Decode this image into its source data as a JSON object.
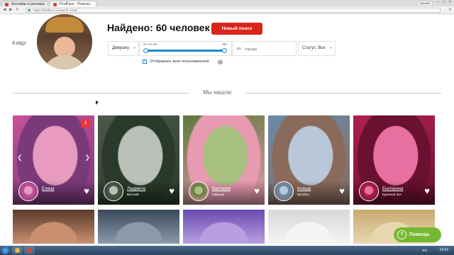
{
  "browser": {
    "tabs": [
      {
        "label": "Анонимы и реклама",
        "color": "#d04a3a"
      },
      {
        "label": "FindFace - Результ...",
        "color": "#d04a3a"
      }
    ],
    "user_label": "Ultimate",
    "url": "https://findface.ru/search-result"
  },
  "header": {
    "looking_for": "Я ИЩУ",
    "found_title": "Найдено: 60 человек",
    "new_search_label": "Новый поиск"
  },
  "filters": {
    "gender": "Девушку",
    "age_from": "От 14 лет",
    "age_to": "55+",
    "age_range_fraction": [
      0.0,
      1.0
    ],
    "city_prefix": "из",
    "city_placeholder": "города",
    "status": "Статус: Все",
    "show_all_checked": true,
    "show_all_label": "Отображать всех пользователей",
    "help_icon": "question-icon"
  },
  "results_heading": "Мы нашли:",
  "cards": [
    {
      "name": "Елена",
      "city": "",
      "badge": "3",
      "colors": [
        "#c8509a",
        "#e89ac0",
        "#7a3a7a"
      ]
    },
    {
      "name": "Людмила",
      "city": "Вятский",
      "badge": "",
      "colors": [
        "#4a5a4a",
        "#b8c0b8",
        "#2a3a2a"
      ]
    },
    {
      "name": "Виктория",
      "city": "Харьков",
      "badge": "",
      "colors": [
        "#5a7a3a",
        "#a8c080",
        "#e89ab0"
      ]
    },
    {
      "name": "Ксюша",
      "city": "Витебск",
      "badge": "",
      "colors": [
        "#6a8aaa",
        "#b8c8d8",
        "#8a6a5a"
      ]
    },
    {
      "name": "Екатерина",
      "city": "Красный Луч",
      "badge": "",
      "colors": [
        "#b02050",
        "#e870a0",
        "#6a1030"
      ]
    }
  ],
  "second_row_colors": [
    [
      "#5a3a2a",
      "#c89070"
    ],
    [
      "#3a4a5a",
      "#8a9aaa"
    ],
    [
      "#6a4ab0",
      "#b8a0e0"
    ],
    [
      "#d8d8d8",
      "#f4f4f4"
    ],
    [
      "#c8a870",
      "#e8d8b0"
    ]
  ],
  "help_button": "Помощь",
  "taskbar": {
    "tray": "RU",
    "clock": "13:42"
  }
}
